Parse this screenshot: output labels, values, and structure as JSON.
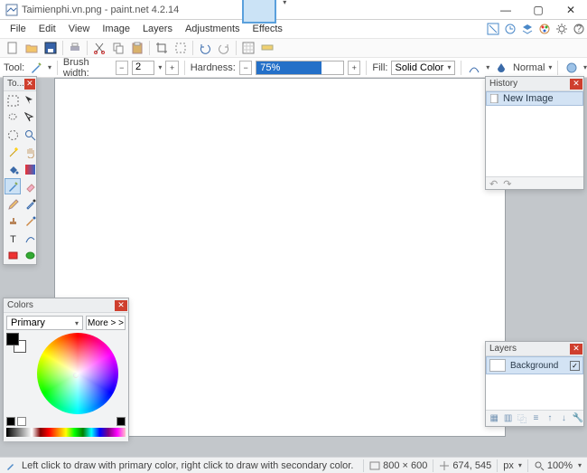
{
  "title": "Taimienphi.vn.png - paint.net 4.2.14",
  "menu": [
    "File",
    "Edit",
    "View",
    "Image",
    "Layers",
    "Adjustments",
    "Effects"
  ],
  "toolopts": {
    "tool_label": "Tool:",
    "brush_width_label": "Brush width:",
    "brush_width_value": "2",
    "hardness_label": "Hardness:",
    "hardness_value": "75%",
    "fill_label": "Fill:",
    "fill_value": "Solid Color",
    "blend_label": "Normal"
  },
  "panels": {
    "tools_title": "To...",
    "history_title": "History",
    "history_item": "New Image",
    "layers_title": "Layers",
    "layer_name": "Background",
    "colors_title": "Colors",
    "primary_label": "Primary",
    "more_label": "More > >"
  },
  "status": {
    "hint": "Left click to draw with primary color, right click to draw with secondary color.",
    "canvas_size": "800 × 600",
    "cursor_pos": "674, 545",
    "unit": "px",
    "zoom": "100%"
  }
}
